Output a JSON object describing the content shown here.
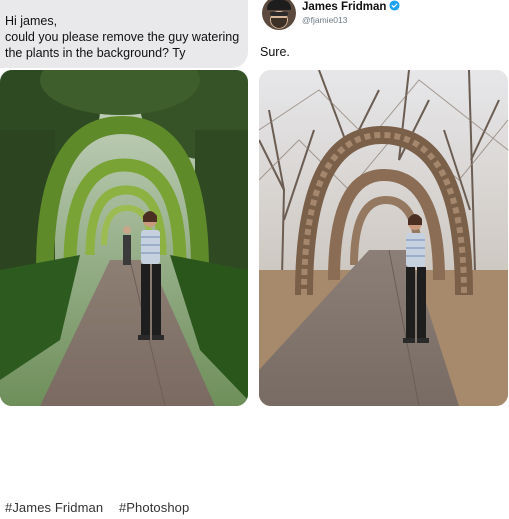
{
  "request": {
    "text": "Hi james,\n could you please remove the guy watering\nthe plants in the background? Ty"
  },
  "profile": {
    "display_name": "James Fridman",
    "handle": "@fjamie013",
    "verified": true,
    "accent_color": "#1da1f2"
  },
  "reply": {
    "text": "Sure."
  },
  "photos": {
    "original": {
      "icon": "photo-garden-arch"
    },
    "edited": {
      "icon": "photo-bare-branch-arch"
    }
  },
  "hashtags": [
    "#James Fridman",
    "#Photoshop"
  ]
}
